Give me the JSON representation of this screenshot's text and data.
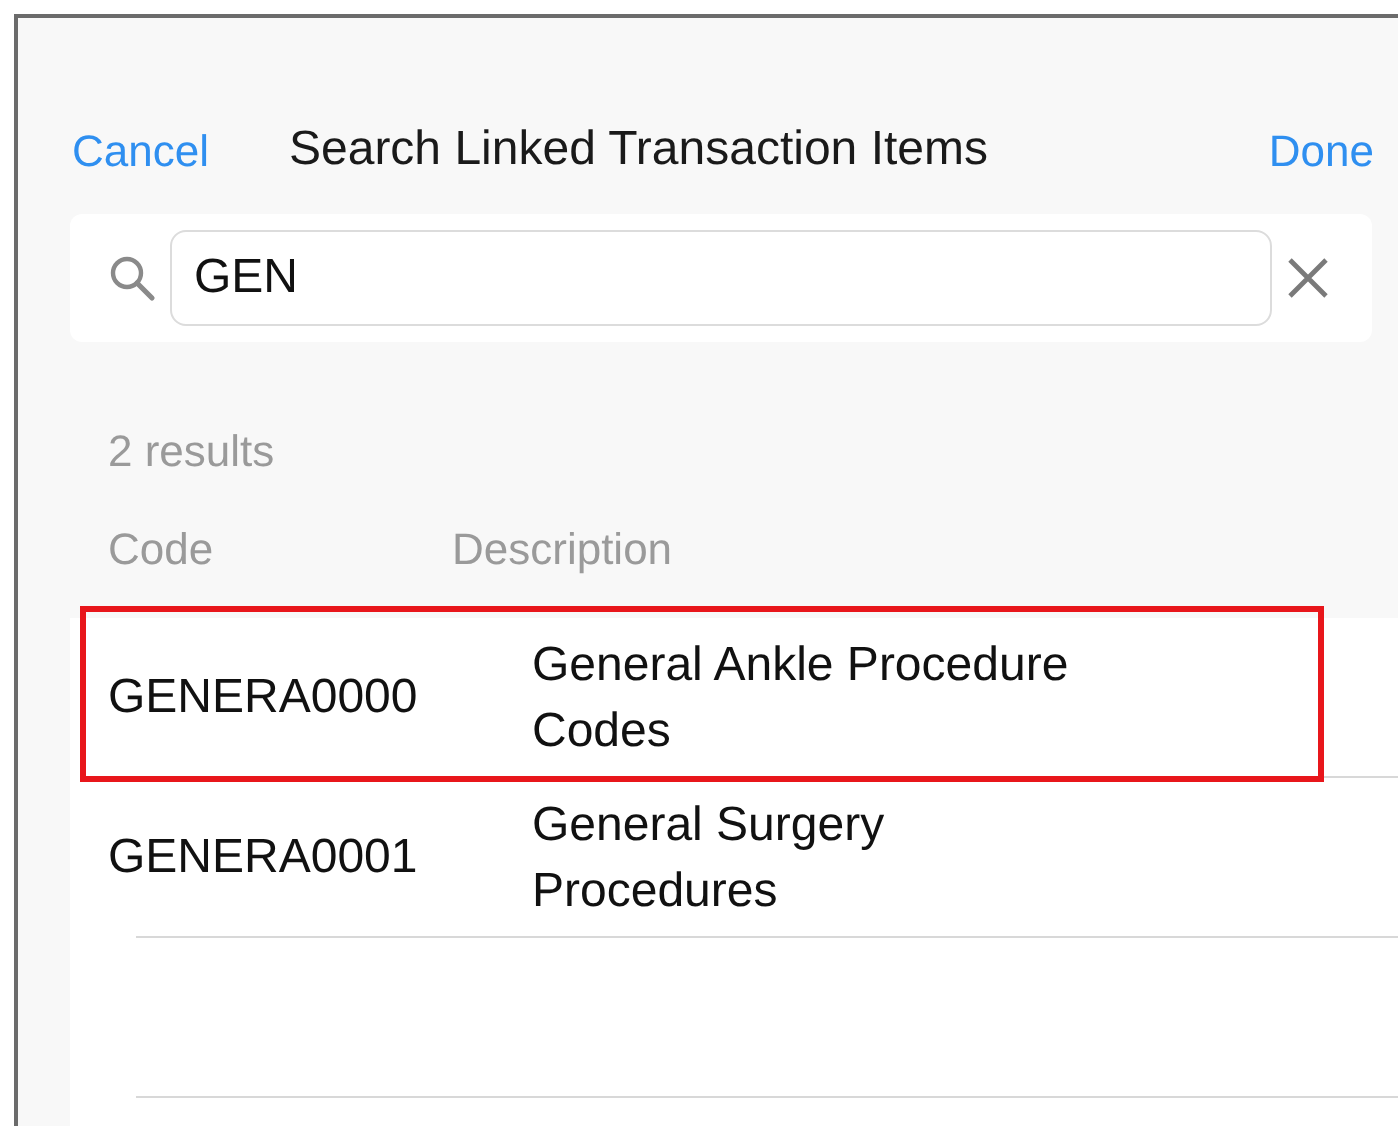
{
  "nav": {
    "cancel": "Cancel",
    "title": "Search Linked Transaction Items",
    "done": "Done"
  },
  "search": {
    "value": "GEN"
  },
  "result_count": "2 results",
  "columns": [
    "Code",
    "Description"
  ],
  "rows": [
    {
      "code": "GENERA0000",
      "description": "General Ankle Procedure Codes",
      "highlighted": true
    },
    {
      "code": "GENERA0001",
      "description": "General Surgery Procedures",
      "highlighted": false
    }
  ]
}
